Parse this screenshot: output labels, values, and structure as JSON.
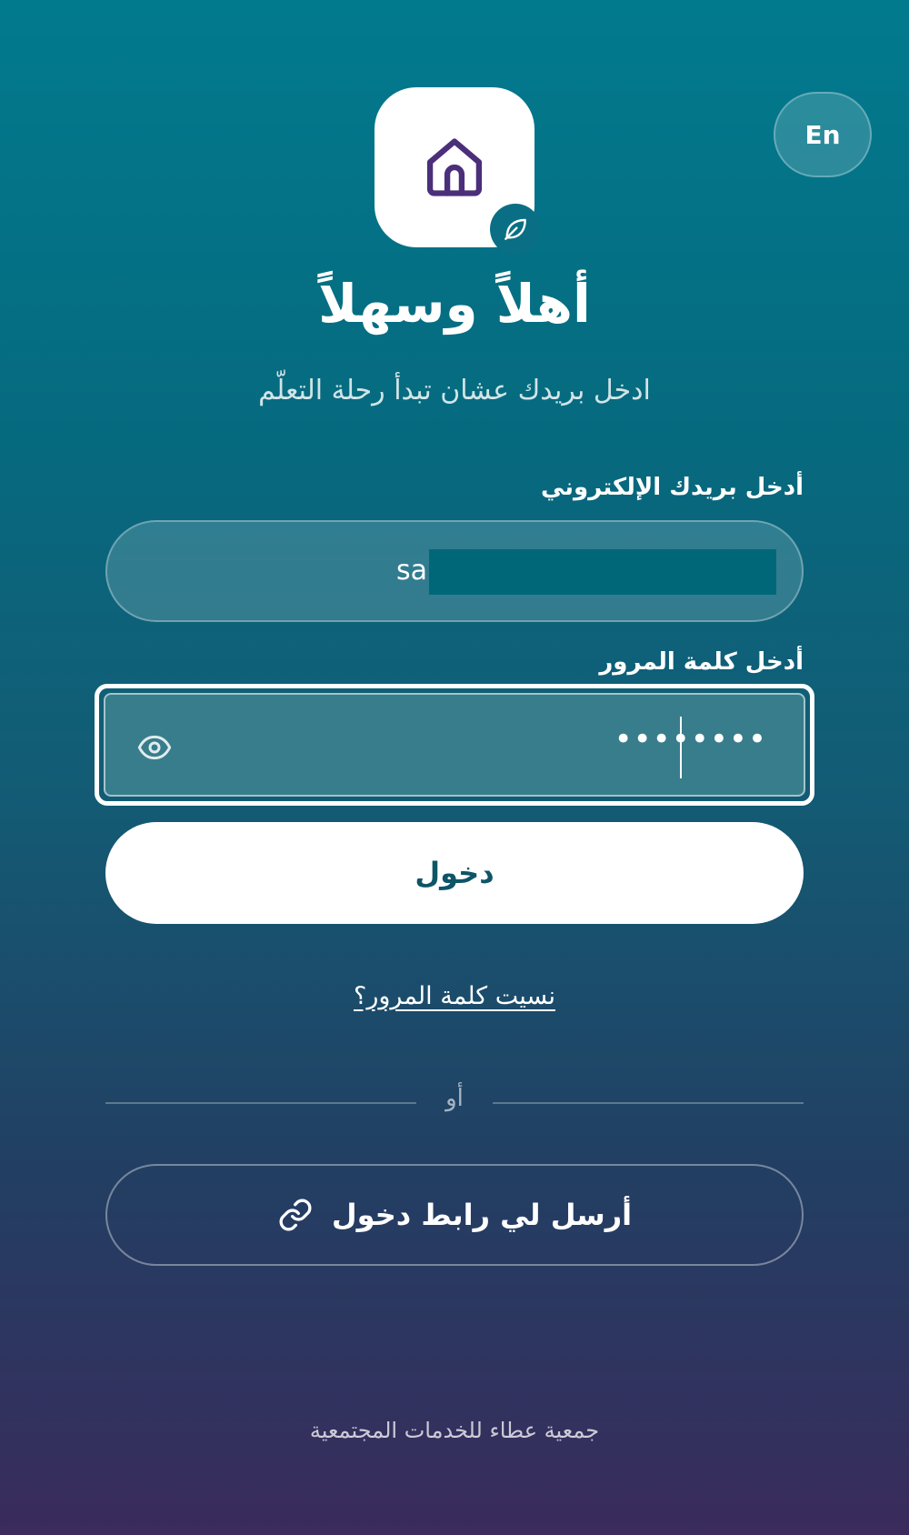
{
  "header": {
    "lang_toggle": "En"
  },
  "branding": {
    "logo_icon": "house-icon",
    "badge_icon": "leaf-icon",
    "logo_color": "#4b2f7a",
    "accent": "#0a6f84"
  },
  "welcome": {
    "title": "أهلاً وسهلاً",
    "subtitle": "ادخل بريدك عشان تبدأ رحلة التعلّم"
  },
  "form": {
    "email_label": "أدخل بريدك الإلكتروني",
    "email_value": "sa",
    "password_label": "أدخل كلمة المرور",
    "password_value": "••••••••",
    "show_password_icon": "eye-icon",
    "login_label": "دخول",
    "forgot_label": "نسيت كلمة المرور؟"
  },
  "divider": {
    "text": "أو"
  },
  "magic_link": {
    "label": "أرسل لي رابط دخول",
    "icon": "link-icon"
  },
  "footer": {
    "org_name": "جمعية عطاء للخدمات المجتمعية"
  }
}
